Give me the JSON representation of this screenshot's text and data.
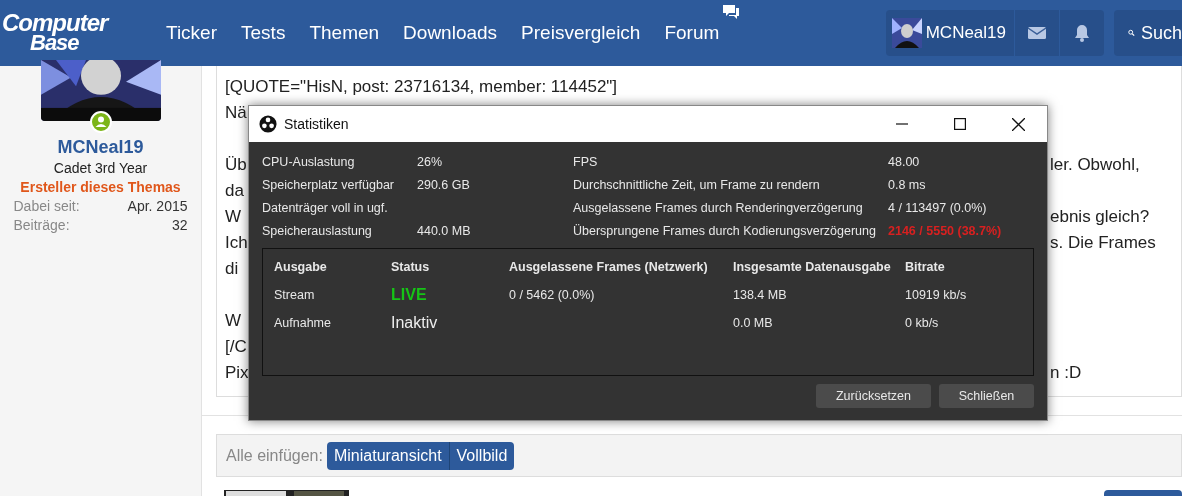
{
  "header": {
    "logo": [
      "Computer",
      "Base"
    ],
    "nav": [
      {
        "label": "Ticker",
        "kind": "plain"
      },
      {
        "label": "Tests",
        "kind": "plain"
      },
      {
        "label": "Themen",
        "kind": "plain"
      },
      {
        "label": "Downloads",
        "kind": "plain"
      },
      {
        "label": "Preisvergleich",
        "kind": "plain"
      },
      {
        "label": "Forum",
        "kind": "chat"
      }
    ],
    "user": "MCNeal19",
    "search": "Such"
  },
  "author": {
    "name": "MCNeal19",
    "online": true,
    "rank": "Cadet 3rd Year",
    "role": "Ersteller dieses Themas",
    "stats": [
      {
        "label": "Dabei seit:",
        "value": "Apr. 2015"
      },
      {
        "label": "Beiträge:",
        "value": "32"
      }
    ]
  },
  "post": {
    "quote": "[QUOTE=\"HisN, post: 23716134, member: 114452\"]",
    "paragraphs": [
      [
        {
          "left": "Nä"
        }
      ],
      [
        {
          "left": "Üb",
          "right": "ler. Obwohl,"
        },
        {
          "left": "da"
        },
        {
          "left": "W",
          "right": "ebnis gleich?"
        },
        {
          "left": "Ich",
          "right": "s. Die Frames"
        },
        {
          "left": "di"
        }
      ],
      [
        {
          "left": "W"
        },
        {
          "left": "[/C"
        },
        {
          "left": "Pix",
          "right": "n :D"
        }
      ]
    ]
  },
  "insert": {
    "label": "Alle einfügen:",
    "options": [
      {
        "label": "Miniaturansicht",
        "selected": true
      },
      {
        "label": "Vollbild",
        "selected": true
      }
    ]
  },
  "dialog": {
    "title": "Statistiken",
    "stats_left": [
      {
        "label": "CPU-Auslastung",
        "value": "26%"
      },
      {
        "label": "Speicherplatz verfügbar",
        "value": "290.6 GB"
      },
      {
        "label": "Datenträger voll in ugf."
      },
      {
        "label": "Speicherauslastung",
        "value": "440.0 MB"
      }
    ],
    "stats_right": [
      {
        "label": "FPS",
        "value": "48.00",
        "warning": false
      },
      {
        "label": "Durchschnittliche Zeit, um Frame zu rendern",
        "value": "0.8 ms",
        "warning": false
      },
      {
        "label": "Ausgelassene Frames durch Renderingverzögerung",
        "value": "4 / 113497 (0.0%)",
        "warning": false
      },
      {
        "label": "Übersprungene Frames durch Kodierungsverzögerung",
        "value": "2146 / 5550 (38.7%)",
        "warning": true
      }
    ],
    "columns": [
      "Ausgabe",
      "Status",
      "Ausgelassene Frames (Netzwerk)",
      "Insgesamte Datenausgabe",
      "Bitrate"
    ],
    "rows": [
      {
        "output": "Stream",
        "status": "LIVE",
        "live": true,
        "dropped": "0 / 5462 (0.0%)",
        "total": "138.4 MB",
        "bitrate": "10919 kb/s"
      },
      {
        "output": "Aufnahme",
        "status": "Inaktiv",
        "live": false,
        "total": "0.0 MB",
        "bitrate": "0 kb/s"
      }
    ],
    "buttons": [
      "Zurücksetzen",
      "Schließen"
    ]
  }
}
